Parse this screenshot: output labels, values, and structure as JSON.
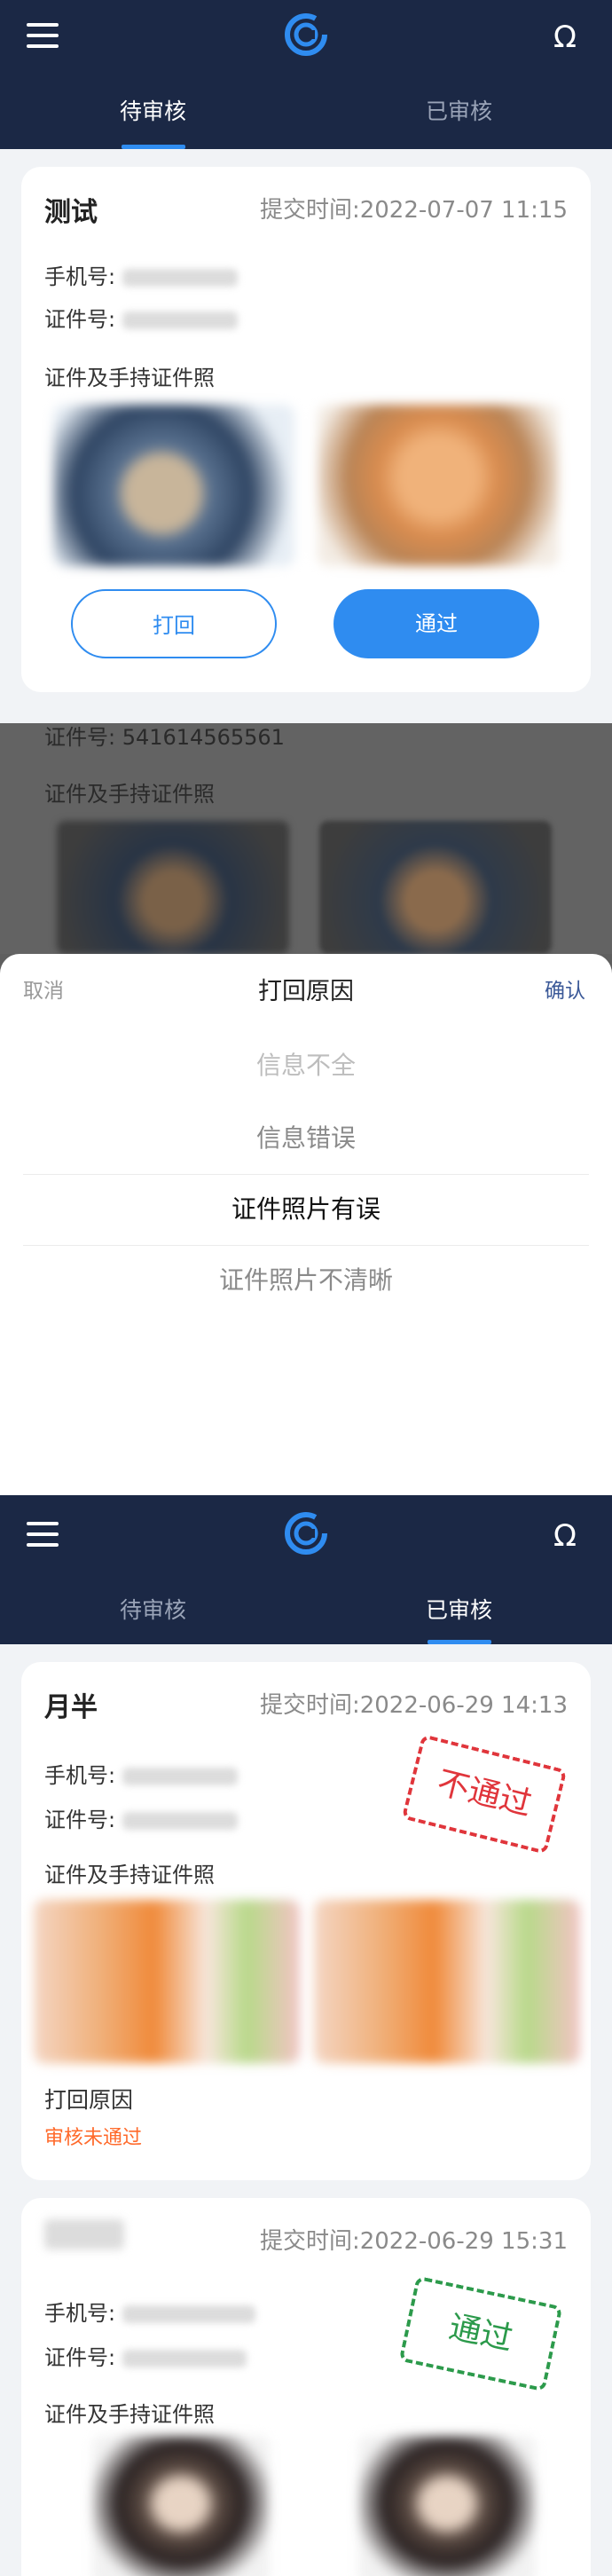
{
  "screen1": {
    "tabs": [
      "待审核",
      "已审核"
    ],
    "card": {
      "name": "测试",
      "time": "提交时间:2022-07-07 11:15",
      "phone_label": "手机号:",
      "id_label": "证件号:",
      "photos_title": "证件及手持证件照",
      "reject_button": "打回",
      "approve_button": "通过"
    }
  },
  "screen2": {
    "bg_id_line": "证件号: 541614565561",
    "bg_photos_title": "证件及手持证件照",
    "sheet": {
      "cancel": "取消",
      "title": "打回原因",
      "confirm": "确认",
      "options": [
        "信息不全",
        "信息错误",
        "证件照片有误",
        "证件照片不清晰"
      ],
      "selected_index": 2
    }
  },
  "screen3": {
    "tabs": [
      "待审核",
      "已审核"
    ],
    "card1": {
      "name": "月半",
      "time": "提交时间:2022-06-29 14:13",
      "phone_label": "手机号:",
      "id_label": "证件号:",
      "photos_title": "证件及手持证件照",
      "stamp": "不通过",
      "reason_title": "打回原因",
      "reason_status": "审核未通过"
    },
    "card2": {
      "time": "提交时间:2022-06-29 15:31",
      "phone_label": "手机号:",
      "id_label": "证件号:",
      "photos_title": "证件及手持证件照",
      "stamp": "通过"
    }
  },
  "colors": {
    "header": "#1b2845",
    "accent": "#2f8cf0",
    "reject_stamp": "#e0353b",
    "approve_stamp": "#2c9a4b",
    "reject_text": "#ff6a2b"
  },
  "icons": [
    "menu-icon",
    "logo-icon",
    "user-icon"
  ]
}
